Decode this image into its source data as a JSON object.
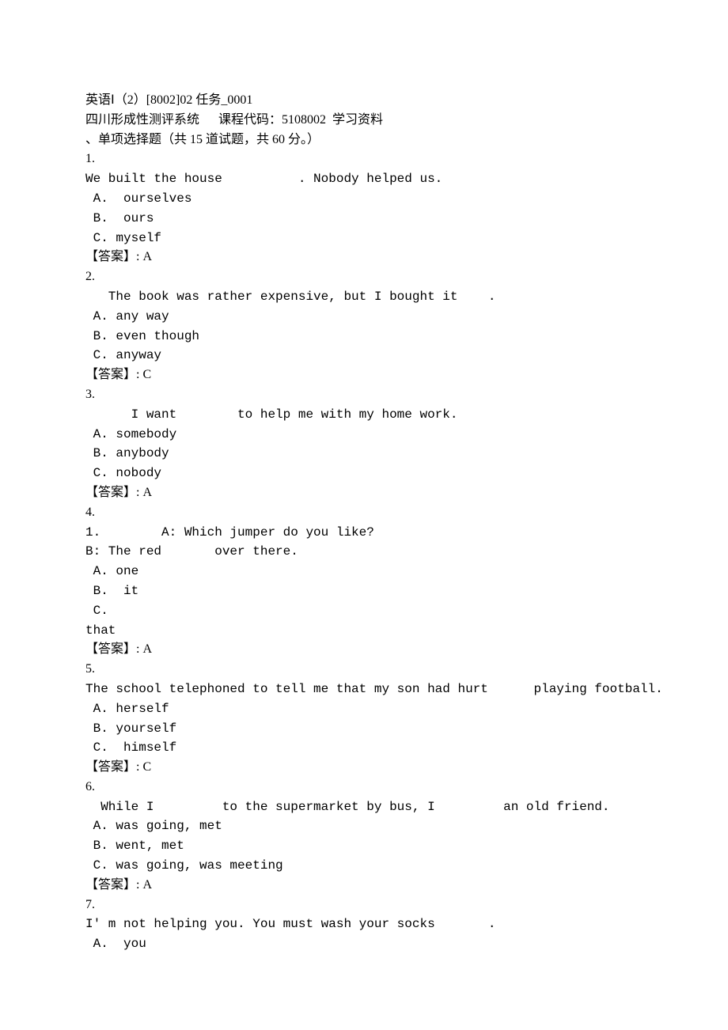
{
  "header": {
    "title": "英语Ⅰ（2）[8002]02 任务_0001",
    "systemLine": "四川形成性测评系统      课程代码：5108002  学习资料",
    "sectionTitle": "、单项选择题（共 15 道试题，共 60 分。）"
  },
  "questions": [
    {
      "num": "1.",
      "textLines": [
        "We built the house          . Nobody helped us."
      ],
      "options": [
        " A.  ourselves",
        " B.  ours",
        " C. myself"
      ],
      "answer": "【答案】: A"
    },
    {
      "num": "2.",
      "textLines": [
        "   The book was rather expensive, but I bought it    ."
      ],
      "options": [
        " A. any way",
        " B. even though",
        " C. anyway"
      ],
      "answer": "【答案】: C"
    },
    {
      "num": "3.",
      "textLines": [
        "      I want        to help me with my home work."
      ],
      "options": [
        " A. somebody",
        " B. anybody",
        " C. nobody"
      ],
      "answer": "【答案】: A"
    },
    {
      "num": "4.",
      "textLines": [
        "1.        A: Which jumper do you like?",
        "B: The red       over there."
      ],
      "options": [
        " A. one",
        " B.  it",
        " C.",
        "that"
      ],
      "answer": "【答案】: A"
    },
    {
      "num": "5.",
      "textLines": [
        "The school telephoned to tell me that my son had hurt      playing football."
      ],
      "options": [
        " A. herself",
        " B. yourself",
        " C.  himself"
      ],
      "answer": "【答案】: C"
    },
    {
      "num": "6.",
      "textLines": [
        "  While I         to the supermarket by bus, I         an old friend."
      ],
      "options": [
        " A. was going, met",
        " B. went, met",
        " C. was going, was meeting"
      ],
      "answer": "【答案】: A"
    },
    {
      "num": "7.",
      "textLines": [
        "I' m not helping you. You must wash your socks       ."
      ],
      "options": [
        " A.  you"
      ],
      "answer": null
    }
  ]
}
